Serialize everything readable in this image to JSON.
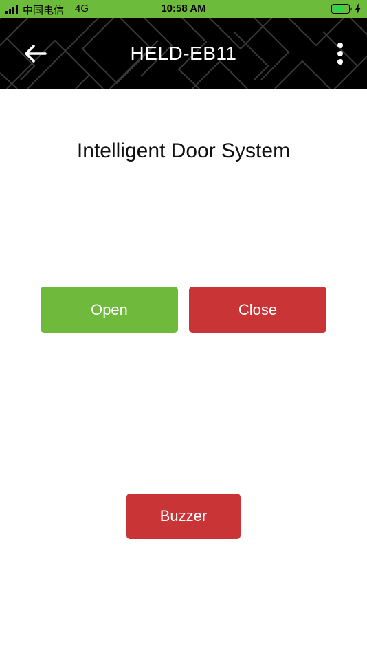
{
  "status_bar": {
    "carrier": "中国电信",
    "network": "4G",
    "time": "10:58 AM",
    "bar_color": "#6dbb3b"
  },
  "header": {
    "title": "HELD-EB11",
    "back_icon": "arrow-left-icon",
    "menu_icon": "more-vertical-icon",
    "background": "#000000"
  },
  "main": {
    "title": "Intelligent Door System",
    "buttons": {
      "open": "Open",
      "close": "Close",
      "buzzer": "Buzzer"
    }
  },
  "colors": {
    "open": "#6fb93d",
    "close": "#c93436",
    "buzzer": "#c93436"
  }
}
